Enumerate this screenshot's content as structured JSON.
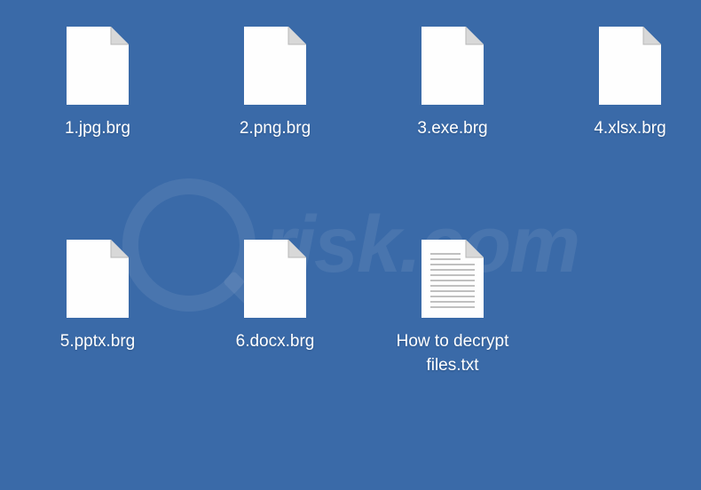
{
  "files": [
    {
      "name": "1.jpg.brg",
      "type": "blank"
    },
    {
      "name": "2.png.brg",
      "type": "blank"
    },
    {
      "name": "3.exe.brg",
      "type": "blank"
    },
    {
      "name": "4.xlsx.brg",
      "type": "blank"
    },
    {
      "name": "5.pptx.brg",
      "type": "blank"
    },
    {
      "name": "6.docx.brg",
      "type": "blank"
    },
    {
      "name": "How to decrypt files.txt",
      "type": "text"
    }
  ],
  "watermark": "risk.com"
}
